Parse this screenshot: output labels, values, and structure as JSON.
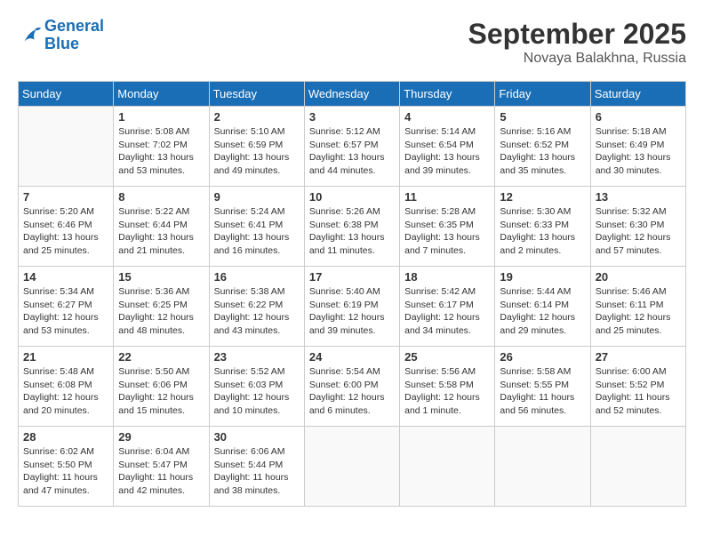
{
  "header": {
    "logo_line1": "General",
    "logo_line2": "Blue",
    "month": "September 2025",
    "location": "Novaya Balakhna, Russia"
  },
  "weekdays": [
    "Sunday",
    "Monday",
    "Tuesday",
    "Wednesday",
    "Thursday",
    "Friday",
    "Saturday"
  ],
  "weeks": [
    [
      {
        "day": "",
        "info": ""
      },
      {
        "day": "1",
        "info": "Sunrise: 5:08 AM\nSunset: 7:02 PM\nDaylight: 13 hours\nand 53 minutes."
      },
      {
        "day": "2",
        "info": "Sunrise: 5:10 AM\nSunset: 6:59 PM\nDaylight: 13 hours\nand 49 minutes."
      },
      {
        "day": "3",
        "info": "Sunrise: 5:12 AM\nSunset: 6:57 PM\nDaylight: 13 hours\nand 44 minutes."
      },
      {
        "day": "4",
        "info": "Sunrise: 5:14 AM\nSunset: 6:54 PM\nDaylight: 13 hours\nand 39 minutes."
      },
      {
        "day": "5",
        "info": "Sunrise: 5:16 AM\nSunset: 6:52 PM\nDaylight: 13 hours\nand 35 minutes."
      },
      {
        "day": "6",
        "info": "Sunrise: 5:18 AM\nSunset: 6:49 PM\nDaylight: 13 hours\nand 30 minutes."
      }
    ],
    [
      {
        "day": "7",
        "info": "Sunrise: 5:20 AM\nSunset: 6:46 PM\nDaylight: 13 hours\nand 25 minutes."
      },
      {
        "day": "8",
        "info": "Sunrise: 5:22 AM\nSunset: 6:44 PM\nDaylight: 13 hours\nand 21 minutes."
      },
      {
        "day": "9",
        "info": "Sunrise: 5:24 AM\nSunset: 6:41 PM\nDaylight: 13 hours\nand 16 minutes."
      },
      {
        "day": "10",
        "info": "Sunrise: 5:26 AM\nSunset: 6:38 PM\nDaylight: 13 hours\nand 11 minutes."
      },
      {
        "day": "11",
        "info": "Sunrise: 5:28 AM\nSunset: 6:35 PM\nDaylight: 13 hours\nand 7 minutes."
      },
      {
        "day": "12",
        "info": "Sunrise: 5:30 AM\nSunset: 6:33 PM\nDaylight: 13 hours\nand 2 minutes."
      },
      {
        "day": "13",
        "info": "Sunrise: 5:32 AM\nSunset: 6:30 PM\nDaylight: 12 hours\nand 57 minutes."
      }
    ],
    [
      {
        "day": "14",
        "info": "Sunrise: 5:34 AM\nSunset: 6:27 PM\nDaylight: 12 hours\nand 53 minutes."
      },
      {
        "day": "15",
        "info": "Sunrise: 5:36 AM\nSunset: 6:25 PM\nDaylight: 12 hours\nand 48 minutes."
      },
      {
        "day": "16",
        "info": "Sunrise: 5:38 AM\nSunset: 6:22 PM\nDaylight: 12 hours\nand 43 minutes."
      },
      {
        "day": "17",
        "info": "Sunrise: 5:40 AM\nSunset: 6:19 PM\nDaylight: 12 hours\nand 39 minutes."
      },
      {
        "day": "18",
        "info": "Sunrise: 5:42 AM\nSunset: 6:17 PM\nDaylight: 12 hours\nand 34 minutes."
      },
      {
        "day": "19",
        "info": "Sunrise: 5:44 AM\nSunset: 6:14 PM\nDaylight: 12 hours\nand 29 minutes."
      },
      {
        "day": "20",
        "info": "Sunrise: 5:46 AM\nSunset: 6:11 PM\nDaylight: 12 hours\nand 25 minutes."
      }
    ],
    [
      {
        "day": "21",
        "info": "Sunrise: 5:48 AM\nSunset: 6:08 PM\nDaylight: 12 hours\nand 20 minutes."
      },
      {
        "day": "22",
        "info": "Sunrise: 5:50 AM\nSunset: 6:06 PM\nDaylight: 12 hours\nand 15 minutes."
      },
      {
        "day": "23",
        "info": "Sunrise: 5:52 AM\nSunset: 6:03 PM\nDaylight: 12 hours\nand 10 minutes."
      },
      {
        "day": "24",
        "info": "Sunrise: 5:54 AM\nSunset: 6:00 PM\nDaylight: 12 hours\nand 6 minutes."
      },
      {
        "day": "25",
        "info": "Sunrise: 5:56 AM\nSunset: 5:58 PM\nDaylight: 12 hours\nand 1 minute."
      },
      {
        "day": "26",
        "info": "Sunrise: 5:58 AM\nSunset: 5:55 PM\nDaylight: 11 hours\nand 56 minutes."
      },
      {
        "day": "27",
        "info": "Sunrise: 6:00 AM\nSunset: 5:52 PM\nDaylight: 11 hours\nand 52 minutes."
      }
    ],
    [
      {
        "day": "28",
        "info": "Sunrise: 6:02 AM\nSunset: 5:50 PM\nDaylight: 11 hours\nand 47 minutes."
      },
      {
        "day": "29",
        "info": "Sunrise: 6:04 AM\nSunset: 5:47 PM\nDaylight: 11 hours\nand 42 minutes."
      },
      {
        "day": "30",
        "info": "Sunrise: 6:06 AM\nSunset: 5:44 PM\nDaylight: 11 hours\nand 38 minutes."
      },
      {
        "day": "",
        "info": ""
      },
      {
        "day": "",
        "info": ""
      },
      {
        "day": "",
        "info": ""
      },
      {
        "day": "",
        "info": ""
      }
    ]
  ]
}
